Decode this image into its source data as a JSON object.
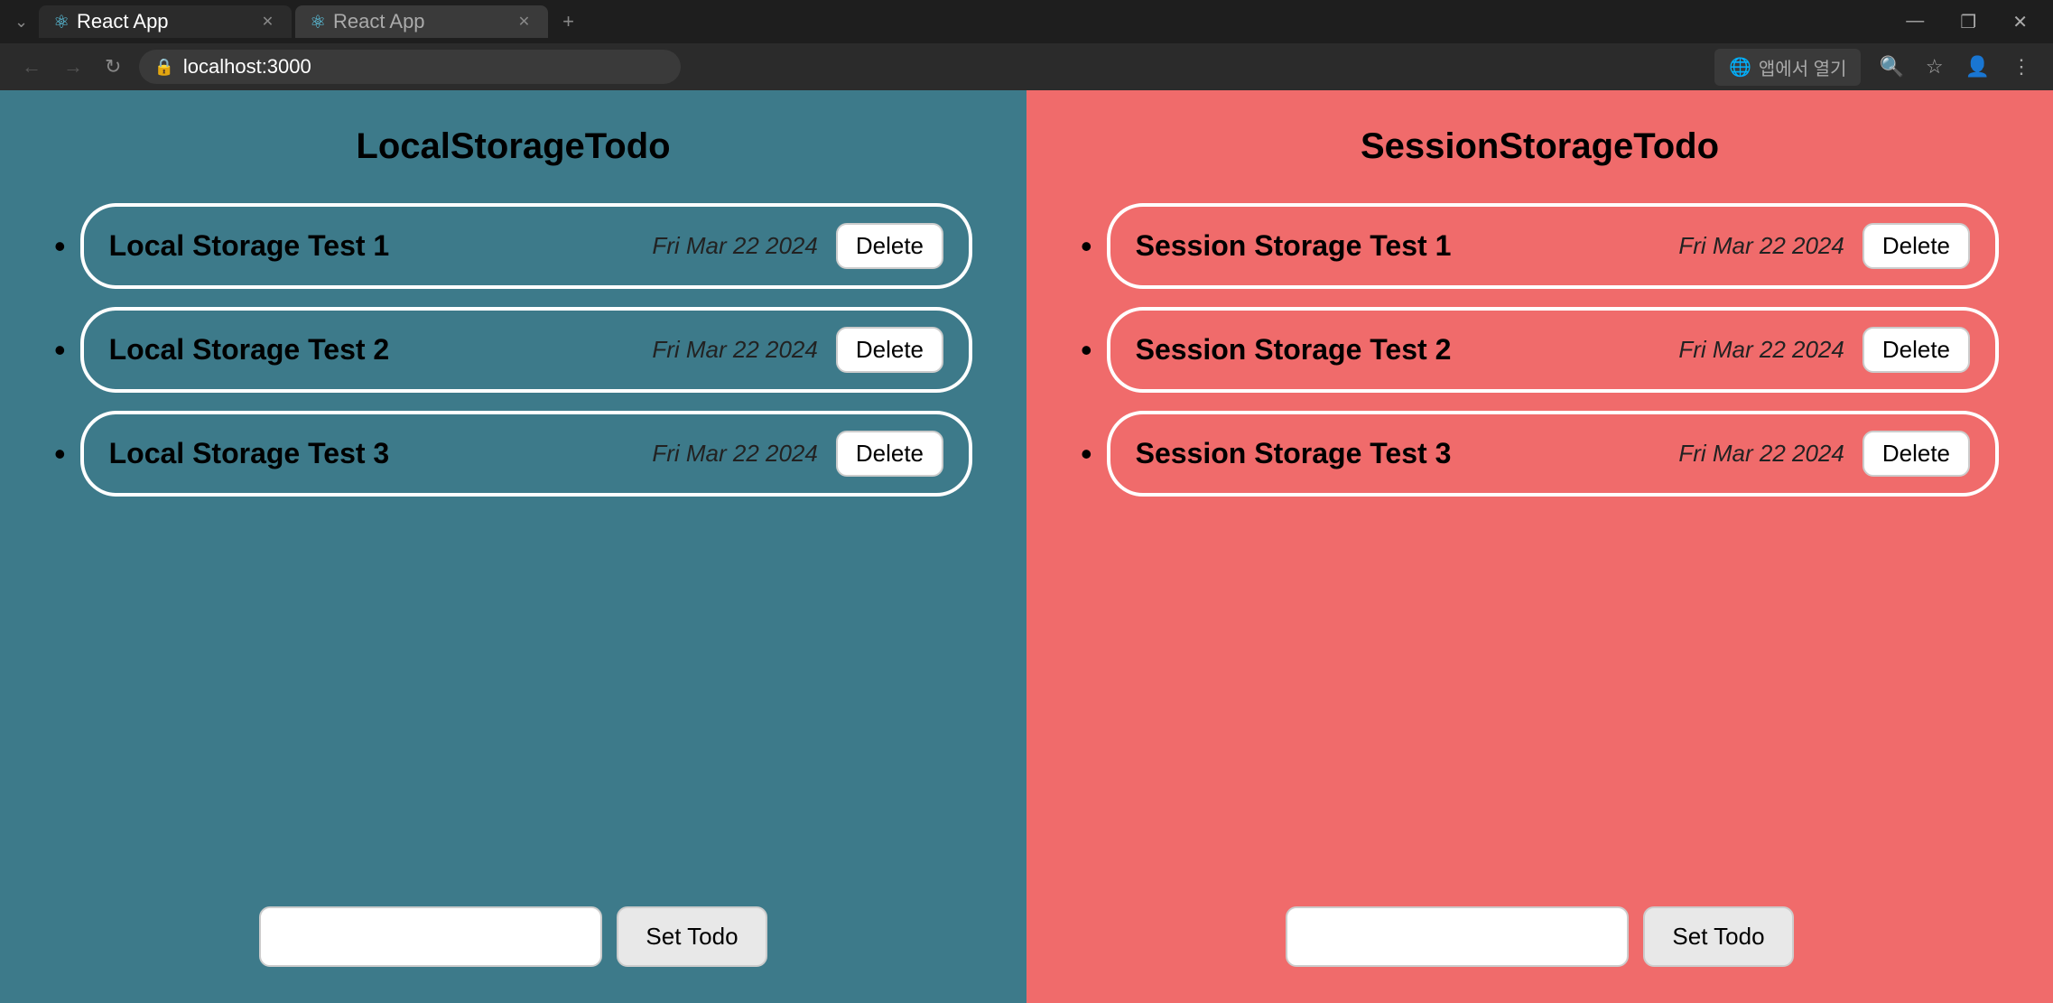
{
  "browser": {
    "tabs": [
      {
        "id": "tab1",
        "title": "React App",
        "active": true,
        "favicon": "⚛"
      },
      {
        "id": "tab2",
        "title": "React App",
        "active": false,
        "favicon": "⚛"
      }
    ],
    "new_tab_label": "+",
    "url": "localhost:3000",
    "open_in_app_label": "앱에서 열기",
    "window_controls": [
      "—",
      "❐",
      "✕"
    ]
  },
  "left_panel": {
    "title": "LocalStorageTodo",
    "todos": [
      {
        "name": "Local Storage Test 1",
        "date": "Fri Mar 22 2024"
      },
      {
        "name": "Local Storage Test 2",
        "date": "Fri Mar 22 2024"
      },
      {
        "name": "Local Storage Test 3",
        "date": "Fri Mar 22 2024"
      }
    ],
    "delete_label": "Delete",
    "input_placeholder": "",
    "set_todo_label": "Set Todo"
  },
  "right_panel": {
    "title": "SessionStorageTodo",
    "todos": [
      {
        "name": "Session Storage Test 1",
        "date": "Fri Mar 22 2024"
      },
      {
        "name": "Session Storage Test 2",
        "date": "Fri Mar 22 2024"
      },
      {
        "name": "Session Storage Test 3",
        "date": "Fri Mar 22 2024"
      }
    ],
    "delete_label": "Delete",
    "input_placeholder": "",
    "set_todo_label": "Set Todo"
  }
}
